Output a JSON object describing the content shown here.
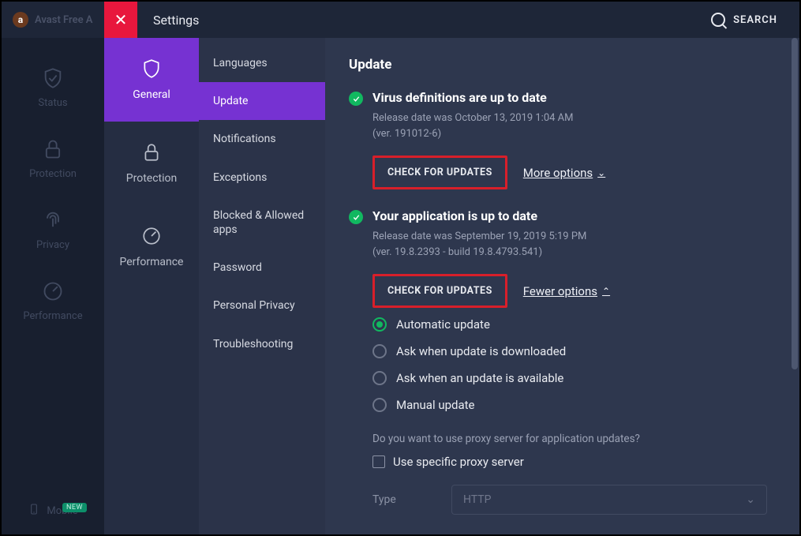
{
  "app": {
    "logo_text": "Avast Free A"
  },
  "header": {
    "title": "Settings",
    "search_label": "SEARCH"
  },
  "farnav": {
    "items": [
      {
        "label": "Status"
      },
      {
        "label": "Protection"
      },
      {
        "label": "Privacy"
      },
      {
        "label": "Performance"
      },
      {
        "label": "Mobile",
        "badge": "NEW"
      }
    ]
  },
  "settings_tabs": {
    "items": [
      {
        "label": "General",
        "active": true
      },
      {
        "label": "Protection"
      },
      {
        "label": "Performance"
      }
    ]
  },
  "submenu": {
    "items": [
      {
        "label": "Languages"
      },
      {
        "label": "Update",
        "active": true
      },
      {
        "label": "Notifications"
      },
      {
        "label": "Exceptions"
      },
      {
        "label": "Blocked & Allowed apps"
      },
      {
        "label": "Password"
      },
      {
        "label": "Personal Privacy"
      },
      {
        "label": "Troubleshooting"
      }
    ]
  },
  "main": {
    "heading": "Update",
    "virus": {
      "title": "Virus definitions are up to date",
      "release": "Release date was October 13, 2019 1:04 AM",
      "version": "(ver. 191012-6)",
      "check_btn": "CHECK FOR UPDATES",
      "options_label": "More options"
    },
    "app_section": {
      "title": "Your application is up to date",
      "release": "Release date was September 19, 2019 5:19 PM",
      "version": "(ver. 19.8.2393 - build 19.8.4793.541)",
      "check_btn": "CHECK FOR UPDATES",
      "options_label": "Fewer options"
    },
    "update_modes": {
      "options": [
        "Automatic update",
        "Ask when update is downloaded",
        "Ask when an update is available",
        "Manual update"
      ],
      "selected_index": 0
    },
    "proxy": {
      "question": "Do you want to use proxy server for application updates?",
      "checkbox_label": "Use specific proxy server",
      "type_label": "Type",
      "type_value": "HTTP"
    }
  }
}
